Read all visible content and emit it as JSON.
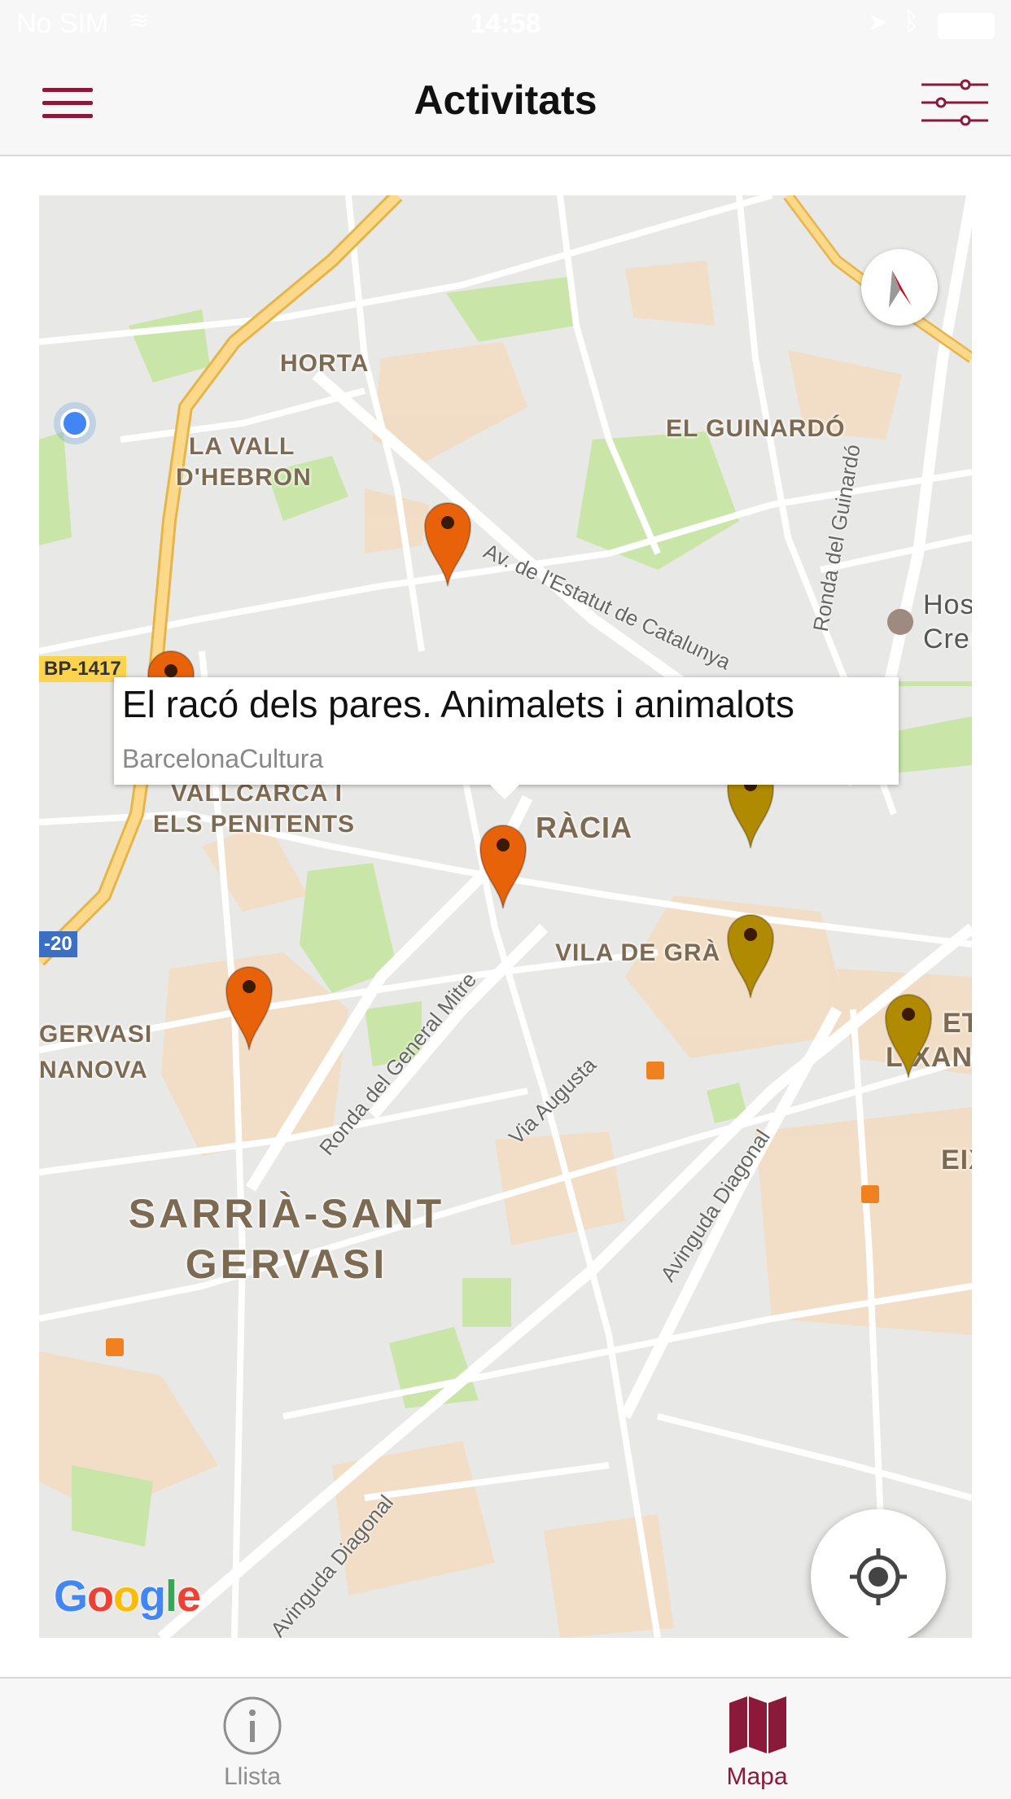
{
  "status_bar": {
    "carrier": "No SIM",
    "time": "14:58"
  },
  "header": {
    "title": "Activitats"
  },
  "map": {
    "labels": {
      "horta": "HORTA",
      "vall_hebron_1": "LA VALL",
      "vall_hebron_2": "D'HEBRON",
      "guinardo": "EL GUINARDÓ",
      "vallcarca_1": "VALLCARCA I",
      "vallcarca_2": "ELS PENITENTS",
      "gracia": "RÀCIA",
      "vila_gracia": "VILA DE GRÀ",
      "gervasi_1": "GERVASI",
      "gervasi_2": "NANOVA",
      "sarria_1": "SARRIÀ-SANT",
      "sarria_2": "GERVASI",
      "hosp_1": "Hos",
      "hosp_2": "Creu",
      "eixample_1": "ETA",
      "eixample_2": "LIXAN",
      "eixample_3": "EIX"
    },
    "streets": {
      "estatut": "Av. de l'Estatut de Catalunya",
      "guinardo": "Ronda del Guinardó",
      "general_mitre": "Ronda del General Mitre",
      "via_augusta": "Via Augusta",
      "diagonal_1": "Avinguda Diagonal",
      "diagonal_2": "Avinguda Diagonal"
    },
    "road_shields": {
      "bp1417": "BP-1417",
      "c20": "-20"
    },
    "google_logo": [
      "G",
      "o",
      "o",
      "g",
      "l",
      "e"
    ],
    "google_colors": [
      "#4285F4",
      "#EA4335",
      "#FBBC05",
      "#4285F4",
      "#34A853",
      "#EA4335"
    ],
    "pin_colors": {
      "orange": "#e8620a",
      "gold": "#b08a00"
    }
  },
  "callout": {
    "title": "El racó dels pares. Animalets i animalots",
    "subtitle": "BarcelonaCultura"
  },
  "tabs": [
    {
      "label": "Llista",
      "icon": "info-icon",
      "active": false
    },
    {
      "label": "Mapa",
      "icon": "map-icon",
      "active": true
    }
  ],
  "colors": {
    "accent": "#8b1a3a",
    "inactive": "#8e8e8e"
  }
}
